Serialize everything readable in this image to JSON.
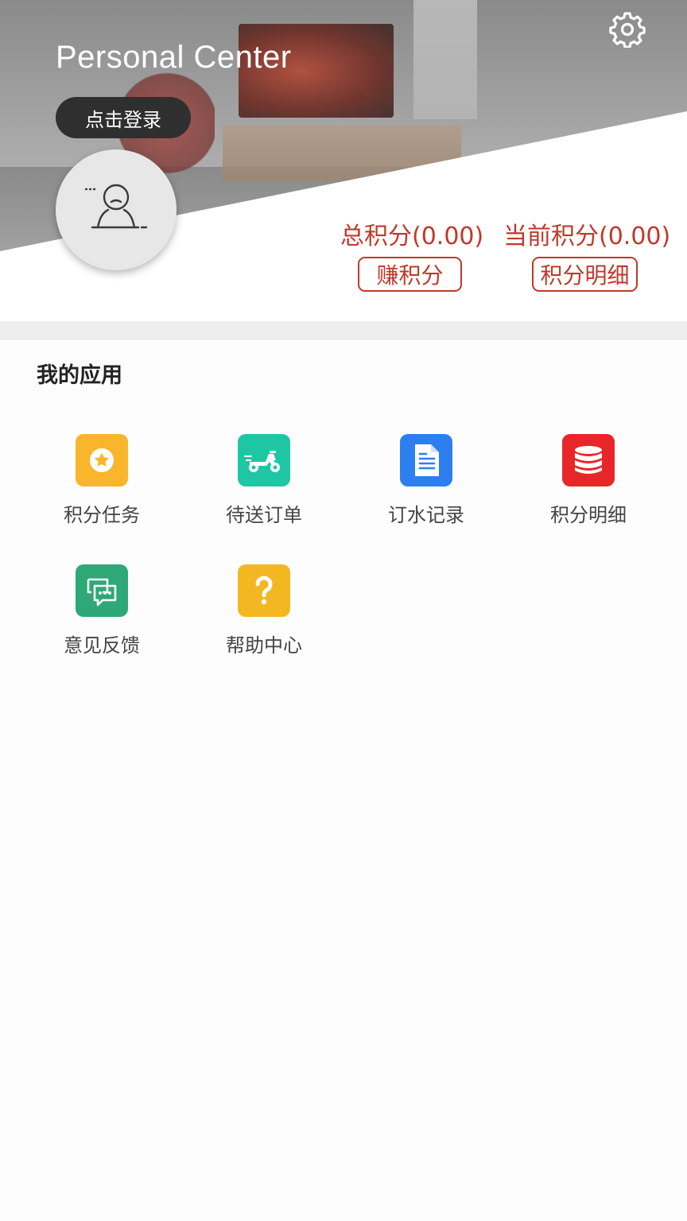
{
  "header": {
    "title": "Personal Center",
    "settings_icon": "gear-icon",
    "login_label": "点击登录",
    "avatar_icon": "user-avatar-icon",
    "total_points_label": "总积分(0.00)",
    "current_points_label": "当前积分(0.00)",
    "earn_points_button": "赚积分",
    "points_detail_button": "积分明细",
    "accent_color": "#c0392b"
  },
  "apps": {
    "section_title": "我的应用",
    "items": [
      {
        "label": "积分任务",
        "icon": "star-badge-icon",
        "color": "#f9b52c"
      },
      {
        "label": "待送订单",
        "icon": "scooter-icon",
        "color": "#1fc6a4"
      },
      {
        "label": "订水记录",
        "icon": "document-icon",
        "color": "#2d7ff0"
      },
      {
        "label": "积分明细",
        "icon": "database-stack-icon",
        "color": "#e8262a"
      },
      {
        "label": "意见反馈",
        "icon": "chat-bubbles-icon",
        "color": "#2ea877"
      },
      {
        "label": "帮助中心",
        "icon": "question-mark-icon",
        "color": "#f3b722"
      }
    ]
  }
}
